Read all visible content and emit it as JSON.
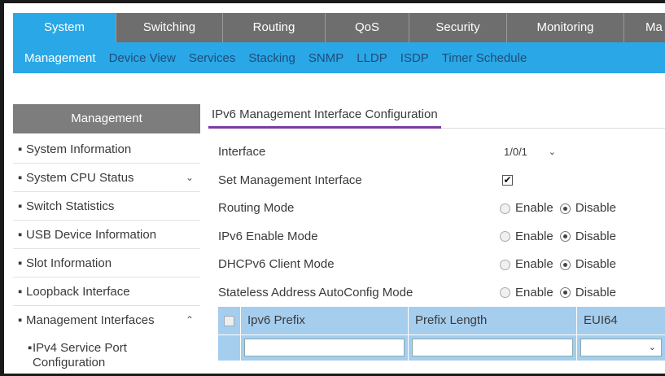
{
  "top_nav": {
    "tabs": [
      {
        "label": "System",
        "active": true
      },
      {
        "label": "Switching",
        "active": false
      },
      {
        "label": "Routing",
        "active": false
      },
      {
        "label": "QoS",
        "active": false
      },
      {
        "label": "Security",
        "active": false
      },
      {
        "label": "Monitoring",
        "active": false
      },
      {
        "label": "Ma",
        "active": false
      }
    ]
  },
  "sub_nav": {
    "items": [
      {
        "label": "Management",
        "active": true
      },
      {
        "label": "Device View",
        "active": false
      },
      {
        "label": "Services",
        "active": false
      },
      {
        "label": "Stacking",
        "active": false
      },
      {
        "label": "SNMP",
        "active": false
      },
      {
        "label": "LLDP",
        "active": false
      },
      {
        "label": "ISDP",
        "active": false
      },
      {
        "label": "Timer Schedule",
        "active": false
      }
    ]
  },
  "sidebar": {
    "header": "Management",
    "items": [
      {
        "label": "System Information"
      },
      {
        "label": "System CPU Status",
        "chevron": "⌄"
      },
      {
        "label": "Switch Statistics"
      },
      {
        "label": "USB Device Information"
      },
      {
        "label": "Slot Information"
      },
      {
        "label": "Loopback Interface"
      },
      {
        "label": "Management Interfaces",
        "chevron": "⌃"
      }
    ],
    "subitem": "IPv4 Service Port Configuration",
    "bullet": "▪"
  },
  "content": {
    "title": "IPv6 Management Interface Configuration",
    "interface_label": "Interface",
    "interface_value": "1/0/1",
    "set_mgmt_label": "Set Management Interface",
    "set_mgmt_checked": true,
    "check_mark": "✔",
    "enable_label": "Enable",
    "disable_label": "Disable",
    "modes": [
      {
        "label": "Routing Mode",
        "value": "Disable"
      },
      {
        "label": "IPv6 Enable Mode",
        "value": "Disable"
      },
      {
        "label": "DHCPv6 Client Mode",
        "value": "Disable"
      },
      {
        "label": "Stateless Address AutoConfig Mode",
        "value": "Disable"
      }
    ]
  },
  "table": {
    "columns": [
      "Ipv6 Prefix",
      "Prefix Length",
      "EUI64"
    ]
  },
  "icons": {
    "chevron_down": "⌄"
  },
  "colors": {
    "accent_blue": "#2aa7e6",
    "nav_gray": "#6e6e6e",
    "title_underline": "#7a3ba3",
    "table_header": "#a5cdee"
  }
}
